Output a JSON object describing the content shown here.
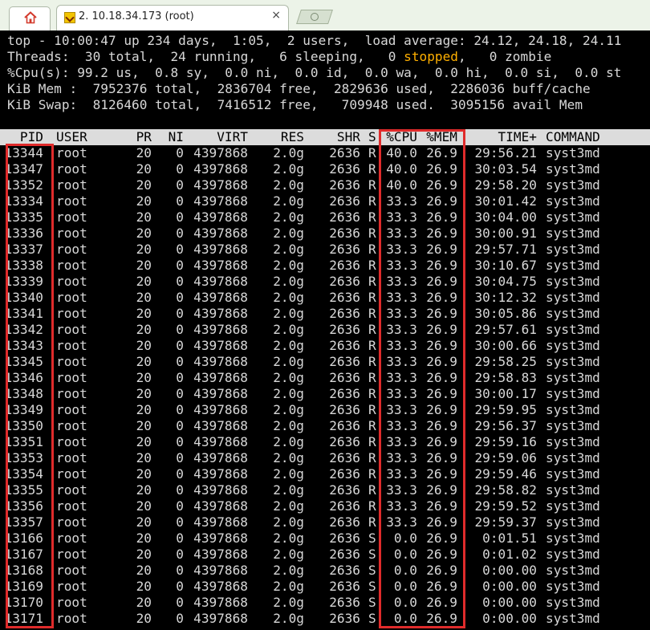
{
  "tabs": {
    "session_title": "2. 10.18.34.173 (root)",
    "close_glyph": "×"
  },
  "summary": {
    "line1": "top - 10:00:47 up 234 days,  1:05,  2 users,  load average: 24.12, 24.18, 24.11",
    "line2_before": "Threads:  30 total,  24 running,   6 sleeping,   0 ",
    "line2_stopped": "stopped",
    "line2_after": ",   0 zombie",
    "line3": "%Cpu(s): 99.2 us,  0.8 sy,  0.0 ni,  0.0 id,  0.0 wa,  0.0 hi,  0.0 si,  0.0 st",
    "line4": "KiB Mem :  7952376 total,  2836704 free,  2829636 used,  2286036 buff/cache",
    "line5": "KiB Swap:  8126460 total,  7416512 free,   709948 used.  3095156 avail Mem"
  },
  "table": {
    "headers": {
      "pid": "PID",
      "user": "USER",
      "pr": "PR",
      "ni": "NI",
      "virt": "VIRT",
      "res": "RES",
      "shr": "SHR",
      "s": "S",
      "cpu": "%CPU",
      "mem": "%MEM",
      "time": "TIME+",
      "command": "COMMAND"
    },
    "rows": [
      {
        "pid": "13344",
        "user": "root",
        "pr": "20",
        "ni": "0",
        "virt": "4397868",
        "res": "2.0g",
        "shr": "2636",
        "s": "R",
        "cpu": "40.0",
        "mem": "26.9",
        "time": "29:56.21",
        "command": "syst3md"
      },
      {
        "pid": "13347",
        "user": "root",
        "pr": "20",
        "ni": "0",
        "virt": "4397868",
        "res": "2.0g",
        "shr": "2636",
        "s": "R",
        "cpu": "40.0",
        "mem": "26.9",
        "time": "30:03.54",
        "command": "syst3md"
      },
      {
        "pid": "13352",
        "user": "root",
        "pr": "20",
        "ni": "0",
        "virt": "4397868",
        "res": "2.0g",
        "shr": "2636",
        "s": "R",
        "cpu": "40.0",
        "mem": "26.9",
        "time": "29:58.20",
        "command": "syst3md"
      },
      {
        "pid": "13334",
        "user": "root",
        "pr": "20",
        "ni": "0",
        "virt": "4397868",
        "res": "2.0g",
        "shr": "2636",
        "s": "R",
        "cpu": "33.3",
        "mem": "26.9",
        "time": "30:01.42",
        "command": "syst3md"
      },
      {
        "pid": "13335",
        "user": "root",
        "pr": "20",
        "ni": "0",
        "virt": "4397868",
        "res": "2.0g",
        "shr": "2636",
        "s": "R",
        "cpu": "33.3",
        "mem": "26.9",
        "time": "30:04.00",
        "command": "syst3md"
      },
      {
        "pid": "13336",
        "user": "root",
        "pr": "20",
        "ni": "0",
        "virt": "4397868",
        "res": "2.0g",
        "shr": "2636",
        "s": "R",
        "cpu": "33.3",
        "mem": "26.9",
        "time": "30:00.91",
        "command": "syst3md"
      },
      {
        "pid": "13337",
        "user": "root",
        "pr": "20",
        "ni": "0",
        "virt": "4397868",
        "res": "2.0g",
        "shr": "2636",
        "s": "R",
        "cpu": "33.3",
        "mem": "26.9",
        "time": "29:57.71",
        "command": "syst3md"
      },
      {
        "pid": "13338",
        "user": "root",
        "pr": "20",
        "ni": "0",
        "virt": "4397868",
        "res": "2.0g",
        "shr": "2636",
        "s": "R",
        "cpu": "33.3",
        "mem": "26.9",
        "time": "30:10.67",
        "command": "syst3md"
      },
      {
        "pid": "13339",
        "user": "root",
        "pr": "20",
        "ni": "0",
        "virt": "4397868",
        "res": "2.0g",
        "shr": "2636",
        "s": "R",
        "cpu": "33.3",
        "mem": "26.9",
        "time": "30:04.75",
        "command": "syst3md"
      },
      {
        "pid": "13340",
        "user": "root",
        "pr": "20",
        "ni": "0",
        "virt": "4397868",
        "res": "2.0g",
        "shr": "2636",
        "s": "R",
        "cpu": "33.3",
        "mem": "26.9",
        "time": "30:12.32",
        "command": "syst3md"
      },
      {
        "pid": "13341",
        "user": "root",
        "pr": "20",
        "ni": "0",
        "virt": "4397868",
        "res": "2.0g",
        "shr": "2636",
        "s": "R",
        "cpu": "33.3",
        "mem": "26.9",
        "time": "30:05.86",
        "command": "syst3md"
      },
      {
        "pid": "13342",
        "user": "root",
        "pr": "20",
        "ni": "0",
        "virt": "4397868",
        "res": "2.0g",
        "shr": "2636",
        "s": "R",
        "cpu": "33.3",
        "mem": "26.9",
        "time": "29:57.61",
        "command": "syst3md"
      },
      {
        "pid": "13343",
        "user": "root",
        "pr": "20",
        "ni": "0",
        "virt": "4397868",
        "res": "2.0g",
        "shr": "2636",
        "s": "R",
        "cpu": "33.3",
        "mem": "26.9",
        "time": "30:00.66",
        "command": "syst3md"
      },
      {
        "pid": "13345",
        "user": "root",
        "pr": "20",
        "ni": "0",
        "virt": "4397868",
        "res": "2.0g",
        "shr": "2636",
        "s": "R",
        "cpu": "33.3",
        "mem": "26.9",
        "time": "29:58.25",
        "command": "syst3md"
      },
      {
        "pid": "13346",
        "user": "root",
        "pr": "20",
        "ni": "0",
        "virt": "4397868",
        "res": "2.0g",
        "shr": "2636",
        "s": "R",
        "cpu": "33.3",
        "mem": "26.9",
        "time": "29:58.83",
        "command": "syst3md"
      },
      {
        "pid": "13348",
        "user": "root",
        "pr": "20",
        "ni": "0",
        "virt": "4397868",
        "res": "2.0g",
        "shr": "2636",
        "s": "R",
        "cpu": "33.3",
        "mem": "26.9",
        "time": "30:00.17",
        "command": "syst3md"
      },
      {
        "pid": "13349",
        "user": "root",
        "pr": "20",
        "ni": "0",
        "virt": "4397868",
        "res": "2.0g",
        "shr": "2636",
        "s": "R",
        "cpu": "33.3",
        "mem": "26.9",
        "time": "29:59.95",
        "command": "syst3md"
      },
      {
        "pid": "13350",
        "user": "root",
        "pr": "20",
        "ni": "0",
        "virt": "4397868",
        "res": "2.0g",
        "shr": "2636",
        "s": "R",
        "cpu": "33.3",
        "mem": "26.9",
        "time": "29:56.37",
        "command": "syst3md"
      },
      {
        "pid": "13351",
        "user": "root",
        "pr": "20",
        "ni": "0",
        "virt": "4397868",
        "res": "2.0g",
        "shr": "2636",
        "s": "R",
        "cpu": "33.3",
        "mem": "26.9",
        "time": "29:59.16",
        "command": "syst3md"
      },
      {
        "pid": "13353",
        "user": "root",
        "pr": "20",
        "ni": "0",
        "virt": "4397868",
        "res": "2.0g",
        "shr": "2636",
        "s": "R",
        "cpu": "33.3",
        "mem": "26.9",
        "time": "29:59.06",
        "command": "syst3md"
      },
      {
        "pid": "13354",
        "user": "root",
        "pr": "20",
        "ni": "0",
        "virt": "4397868",
        "res": "2.0g",
        "shr": "2636",
        "s": "R",
        "cpu": "33.3",
        "mem": "26.9",
        "time": "29:59.46",
        "command": "syst3md"
      },
      {
        "pid": "13355",
        "user": "root",
        "pr": "20",
        "ni": "0",
        "virt": "4397868",
        "res": "2.0g",
        "shr": "2636",
        "s": "R",
        "cpu": "33.3",
        "mem": "26.9",
        "time": "29:58.82",
        "command": "syst3md"
      },
      {
        "pid": "13356",
        "user": "root",
        "pr": "20",
        "ni": "0",
        "virt": "4397868",
        "res": "2.0g",
        "shr": "2636",
        "s": "R",
        "cpu": "33.3",
        "mem": "26.9",
        "time": "29:59.52",
        "command": "syst3md"
      },
      {
        "pid": "13357",
        "user": "root",
        "pr": "20",
        "ni": "0",
        "virt": "4397868",
        "res": "2.0g",
        "shr": "2636",
        "s": "R",
        "cpu": "33.3",
        "mem": "26.9",
        "time": "29:59.37",
        "command": "syst3md"
      },
      {
        "pid": "13166",
        "user": "root",
        "pr": "20",
        "ni": "0",
        "virt": "4397868",
        "res": "2.0g",
        "shr": "2636",
        "s": "S",
        "cpu": "0.0",
        "mem": "26.9",
        "time": "0:01.51",
        "command": "syst3md"
      },
      {
        "pid": "13167",
        "user": "root",
        "pr": "20",
        "ni": "0",
        "virt": "4397868",
        "res": "2.0g",
        "shr": "2636",
        "s": "S",
        "cpu": "0.0",
        "mem": "26.9",
        "time": "0:01.02",
        "command": "syst3md"
      },
      {
        "pid": "13168",
        "user": "root",
        "pr": "20",
        "ni": "0",
        "virt": "4397868",
        "res": "2.0g",
        "shr": "2636",
        "s": "S",
        "cpu": "0.0",
        "mem": "26.9",
        "time": "0:00.00",
        "command": "syst3md"
      },
      {
        "pid": "13169",
        "user": "root",
        "pr": "20",
        "ni": "0",
        "virt": "4397868",
        "res": "2.0g",
        "shr": "2636",
        "s": "S",
        "cpu": "0.0",
        "mem": "26.9",
        "time": "0:00.00",
        "command": "syst3md"
      },
      {
        "pid": "13170",
        "user": "root",
        "pr": "20",
        "ni": "0",
        "virt": "4397868",
        "res": "2.0g",
        "shr": "2636",
        "s": "S",
        "cpu": "0.0",
        "mem": "26.9",
        "time": "0:00.00",
        "command": "syst3md"
      },
      {
        "pid": "13171",
        "user": "root",
        "pr": "20",
        "ni": "0",
        "virt": "4397868",
        "res": "2.0g",
        "shr": "2636",
        "s": "S",
        "cpu": "0.0",
        "mem": "26.9",
        "time": "0:00.00",
        "command": "syst3md"
      }
    ]
  },
  "icons": {
    "home": "home-icon",
    "tab": "terminal-session-icon",
    "new_tab": "new-tab-icon"
  },
  "colors": {
    "terminal_bg": "#000000",
    "terminal_fg": "#d8d8d8",
    "header_bar": "#dcdcdc",
    "stopped": "#ffb000",
    "highlight": "#e02b2b",
    "tabbar_bg": "#ecf3e8"
  }
}
